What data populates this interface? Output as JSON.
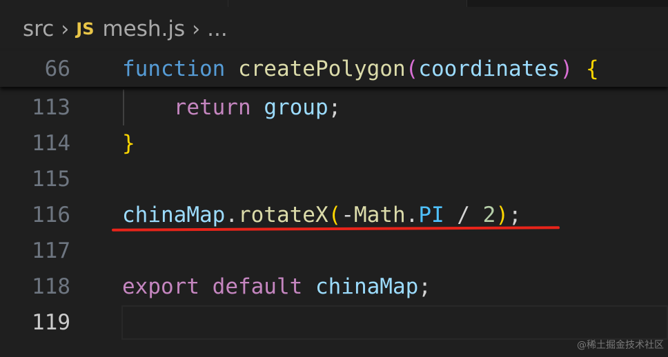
{
  "breadcrumb": {
    "folder": "src",
    "file_icon": "JS",
    "file": "mesh.js",
    "more": "..."
  },
  "lines": {
    "sticky": {
      "number": "66",
      "tokens": [
        "function",
        " ",
        "createPolygon",
        "(",
        "coordinates",
        ")",
        " ",
        "{"
      ]
    },
    "l113": {
      "number": "113",
      "tokens": [
        "    ",
        "return",
        " ",
        "group",
        ";"
      ]
    },
    "l114": {
      "number": "114",
      "tokens": [
        "}"
      ]
    },
    "l115": {
      "number": "115"
    },
    "l116": {
      "number": "116",
      "tokens": [
        "chinaMap",
        ".",
        "rotateX",
        "(",
        "-",
        "Math",
        ".",
        "PI",
        " / ",
        "2",
        ")",
        ";"
      ]
    },
    "l117": {
      "number": "117"
    },
    "l118": {
      "number": "118",
      "tokens": [
        "export",
        " ",
        "default",
        " ",
        "chinaMap",
        ";"
      ]
    },
    "l119": {
      "number": "119"
    }
  },
  "icons": {
    "separator": "chevron-right-icon",
    "file_type": "javascript-file-icon"
  },
  "colors": {
    "background": "#1f1f1f",
    "keyword": "#569cd6",
    "function": "#dcdcaa",
    "variable": "#9cdcfe",
    "control": "#c586c0",
    "brace": "#ffd700",
    "underline": "#e8241a"
  },
  "watermark": "@稀土掘金技术社区"
}
